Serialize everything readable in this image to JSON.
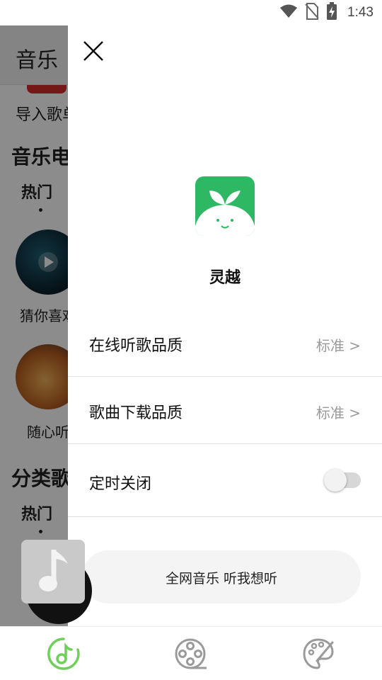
{
  "status_bar": {
    "time": "1:43",
    "icons": [
      "wifi-icon",
      "no-sim-icon",
      "battery-charging-icon"
    ]
  },
  "background_app": {
    "header_title": "音乐",
    "import_label": "导入歌单",
    "section_radio": "音乐电台",
    "tab_hot": "热门",
    "guess_label": "猜你喜欢",
    "random_label": "随心听",
    "section_category": "分类歌单",
    "tab_hot_2": "热门"
  },
  "drawer": {
    "close_icon": "close-icon",
    "app_name": "灵越",
    "settings": [
      {
        "label": "在线听歌品质",
        "value": "标准 >"
      },
      {
        "label": "歌曲下载品质",
        "value": "标准 >"
      },
      {
        "label": "定时关闭",
        "toggle": false
      }
    ],
    "promo_text": "全网音乐 听我想听"
  },
  "bottom_nav": {
    "items": [
      {
        "icon": "music-note-icon",
        "active": true
      },
      {
        "icon": "film-reel-icon",
        "active": false
      },
      {
        "icon": "palette-icon",
        "active": false
      }
    ]
  },
  "colors": {
    "accent": "#6fcf5a",
    "logo_green": "#2fb864",
    "divider": "#e3e3e3",
    "value_gray": "#999999",
    "nav_gray": "#9a9a9a"
  }
}
